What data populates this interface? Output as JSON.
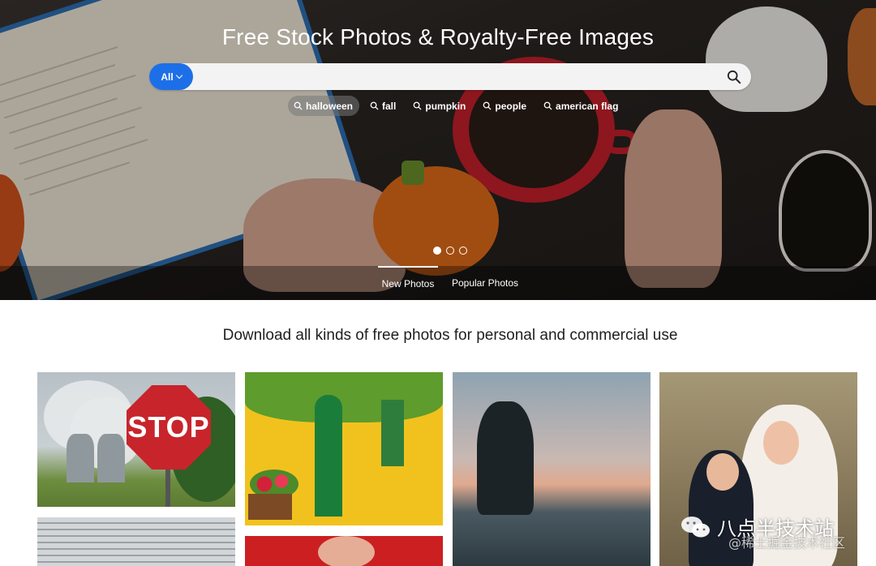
{
  "hero": {
    "title": "Free Stock Photos & Royalty-Free Images",
    "search": {
      "scope_label": "All",
      "placeholder": "",
      "value": ""
    },
    "suggestions": [
      {
        "label": "halloween",
        "active": true
      },
      {
        "label": "fall",
        "active": false
      },
      {
        "label": "pumpkin",
        "active": false
      },
      {
        "label": "people",
        "active": false
      },
      {
        "label": "american flag",
        "active": false
      }
    ],
    "carousel": {
      "slide_count": 3,
      "active_index": 0
    },
    "tabs": [
      {
        "label": "New Photos",
        "active": true
      },
      {
        "label": "Popular Photos",
        "active": false
      }
    ]
  },
  "tagline": "Download all kinds of free photos for personal and commercial use",
  "photos": [
    {
      "subject": "stop sign with cooling towers",
      "sign_text": "STOP"
    },
    {
      "subject": "yellow house with green door and ivy"
    },
    {
      "subject": "silhouette of woman in sea at sunset"
    },
    {
      "subject": "flower girl and ring bearer"
    },
    {
      "subject": "metal shutters"
    },
    {
      "subject": "red poinsettia"
    }
  ],
  "watermark": {
    "title": "八点半技术站",
    "subtitle": "@稀土掘金技术社区"
  },
  "colors": {
    "accent": "#1d6fe8",
    "hero_overlay": "#000000",
    "text": "#1f1f1f"
  }
}
